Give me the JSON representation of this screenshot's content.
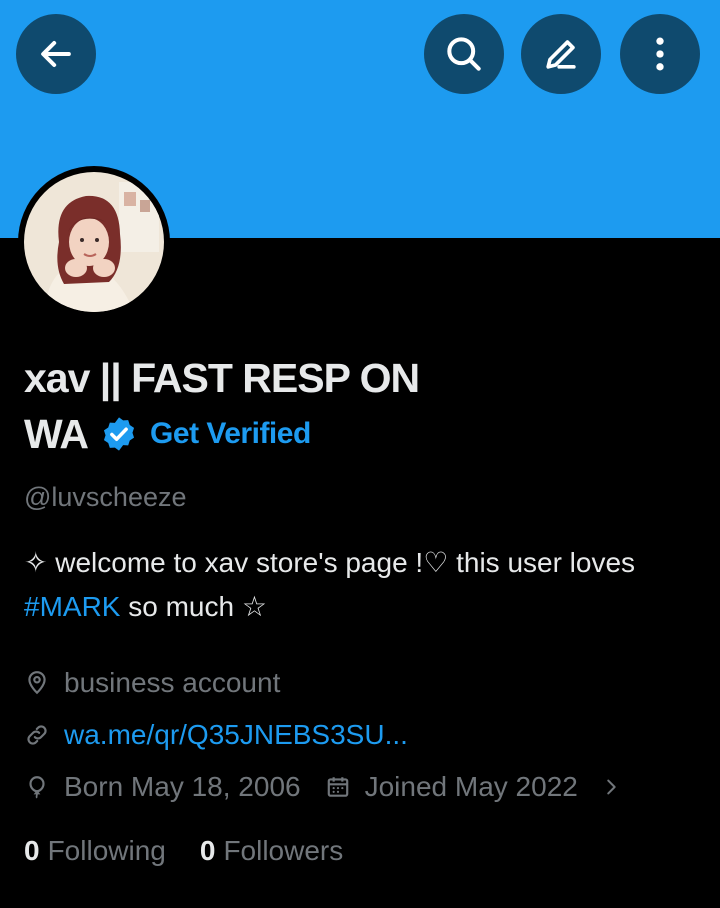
{
  "header": {
    "back_icon": "arrow-left-icon",
    "search_icon": "search-icon",
    "edit_icon": "pencil-icon",
    "more_icon": "more-vertical-icon",
    "banner_color": "#1d9bf0"
  },
  "profile": {
    "name_line1": "xav || FAST RESP ON",
    "name_line2": "WA",
    "get_verified": "Get Verified",
    "handle": "@luvscheeze",
    "bio_part1": "✧ welcome to xav store's page !♡ this user loves ",
    "bio_hashtag": "#MARK",
    "bio_part2": " so much ☆",
    "category": "business account",
    "link": "wa.me/qr/Q35JNEBS3SU...",
    "born": "Born May 18, 2006",
    "joined": "Joined May 2022",
    "following_count": "0",
    "following_label": "Following",
    "followers_count": "0",
    "followers_label": "Followers"
  },
  "colors": {
    "accent": "#1d9bf0",
    "muted": "#71767b",
    "text": "#e7e9ea",
    "background": "#000000"
  }
}
